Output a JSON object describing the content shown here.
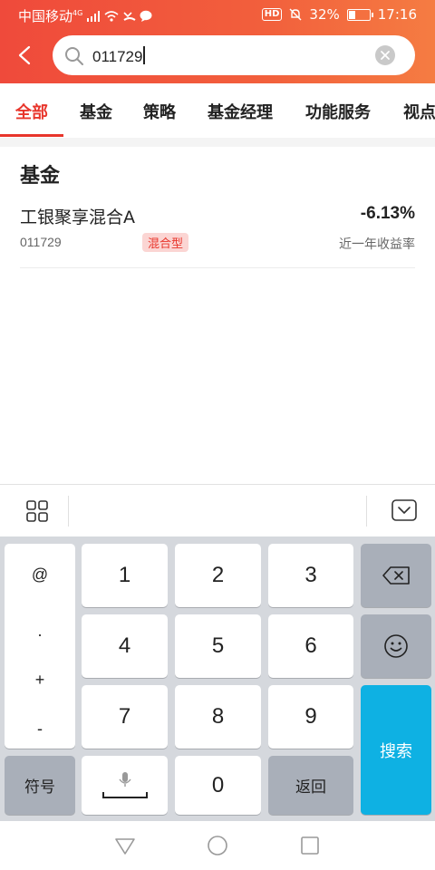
{
  "status_bar": {
    "carrier": "中国移动",
    "network": "4G",
    "hd": "HD",
    "battery": "32%",
    "battery_level": 0.32,
    "time": "17:16"
  },
  "search": {
    "value": "011729"
  },
  "tabs": [
    {
      "label": "全部",
      "active": true
    },
    {
      "label": "基金",
      "active": false
    },
    {
      "label": "策略",
      "active": false
    },
    {
      "label": "基金经理",
      "active": false
    },
    {
      "label": "功能服务",
      "active": false
    },
    {
      "label": "视点",
      "active": false
    }
  ],
  "results": {
    "section_title": "基金",
    "funds": [
      {
        "name": "工银聚享混合A",
        "code": "011729",
        "type": "混合型",
        "return": "-6.13%",
        "return_label": "近一年收益率"
      }
    ]
  },
  "keyboard": {
    "symbols": [
      "@",
      ".",
      "+",
      "-"
    ],
    "digits": [
      "1",
      "2",
      "3",
      "4",
      "5",
      "6",
      "7",
      "8",
      "9",
      "0"
    ],
    "symbols_key": "符号",
    "return_key": "返回",
    "search_key": "搜索"
  },
  "colors": {
    "accent": "#e8352b",
    "header_start": "#ef4a3b",
    "header_end": "#f57c42",
    "search_key": "#0eb1e3"
  }
}
